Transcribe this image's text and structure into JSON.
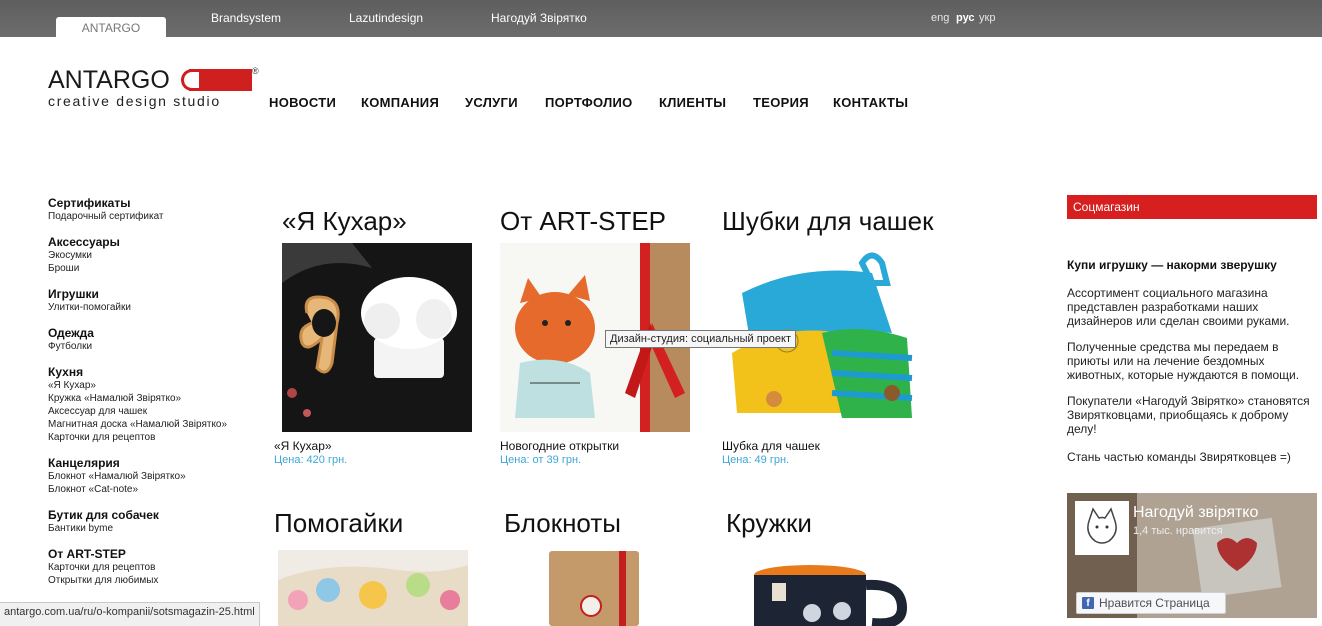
{
  "top_bar": {
    "active_tab": "ANTARGO",
    "sites": [
      "Brandsystem",
      "Lazutindesign",
      "Нагодуй Звірятко"
    ],
    "languages": [
      {
        "label": "eng",
        "active": false
      },
      {
        "label": "рус",
        "active": true
      },
      {
        "label": "укр",
        "active": false
      }
    ]
  },
  "logo": {
    "wordmark": "ANTARGO",
    "tagline": "creative design studio",
    "registered": "®"
  },
  "main_nav": [
    "НОВОСТИ",
    "КОМПАНИЯ",
    "УСЛУГИ",
    "ПОРТФОЛИО",
    "КЛИЕНТЫ",
    "ТЕОРИЯ",
    "КОНТАКТЫ"
  ],
  "categories": [
    {
      "title": "Сертификаты",
      "items": [
        "Подарочный сертификат"
      ]
    },
    {
      "title": "Аксессуары",
      "items": [
        "Экосумки",
        "Броши"
      ]
    },
    {
      "title": "Игрушки",
      "items": [
        "Улитки-помогайки"
      ]
    },
    {
      "title": "Одежда",
      "items": [
        "Футболки"
      ]
    },
    {
      "title": "Кухня",
      "items": [
        "«Я Кухар»",
        "Кружка «Намалюй Звірятко»",
        "Аксессуар для чашек",
        "Магнитная доска «Намалюй Звірятко»",
        "Карточки для рецептов"
      ]
    },
    {
      "title": "Канцелярия",
      "items": [
        "Блокнот «Намалюй Звірятко»",
        "Блокнот «Cat-note»"
      ]
    },
    {
      "title": "Бутик для собачек",
      "items": [
        "Бантики byme"
      ]
    },
    {
      "title": "От ART-STEP",
      "items": [
        "Карточки для рецептов",
        "Открытки для любимых"
      ]
    }
  ],
  "products": [
    {
      "title": "«Я Кухар»",
      "name": "«Я Кухар»",
      "price": "Цена: 420 грн."
    },
    {
      "title": "От ART-STEP",
      "name": "Новогодние открытки",
      "price": "Цена: от 39 грн."
    },
    {
      "title": "Шубки для чашек",
      "name": "Шубка для чашек",
      "price": "Цена: 49 грн."
    },
    {
      "title": "Помогайки"
    },
    {
      "title": "Блокноты"
    },
    {
      "title": "Кружки"
    }
  ],
  "tooltip": "Дизайн-студия: социальный проект",
  "sidebar_right": {
    "header": "Соцмагазин",
    "title": "Купи игрушку — накорми зверушку",
    "paragraphs": [
      "Ассортимент социального магазина представлен разработками наших дизайнеров или сделан своими руками.",
      "Полученные средства мы передаем в приюты или на лечение бездомных животных, которые нуждаются в помощи.",
      "Покупатели «Нагодуй Звірятко» становятся Звирятковцами, приобщаясь к доброму делу!",
      "Стань частью команды Звирятковцев =)"
    ],
    "facebook": {
      "page_name": "Нагодуй звірятко",
      "likes": "1,4 тыс. нравится",
      "like_button": "Нравится Страница",
      "fb_icon": "f"
    }
  },
  "status_url": "antargo.com.ua/ru/o-kompanii/sotsmagazin-25.html",
  "colors": {
    "accent_red": "#d71f1f",
    "price_blue": "#3ba7d8",
    "topbar": "#666666"
  }
}
